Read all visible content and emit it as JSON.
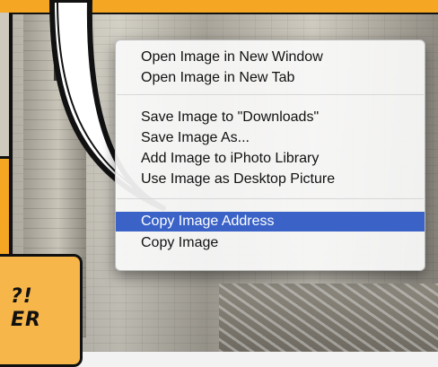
{
  "context_menu": {
    "groups": [
      [
        "Open Image in New Window",
        "Open Image in New Tab"
      ],
      [
        "Save Image to \"Downloads\"",
        "Save Image As...",
        "Add Image to iPhoto Library",
        "Use Image as Desktop Picture"
      ],
      [
        "Copy Image Address",
        "Copy Image"
      ]
    ],
    "highlighted_item": "Copy Image Address"
  },
  "caption": {
    "line1": "?!",
    "line2": "ER"
  },
  "colors": {
    "panel_yellow": "#f5a623",
    "menu_highlight": "#3b63c7"
  }
}
